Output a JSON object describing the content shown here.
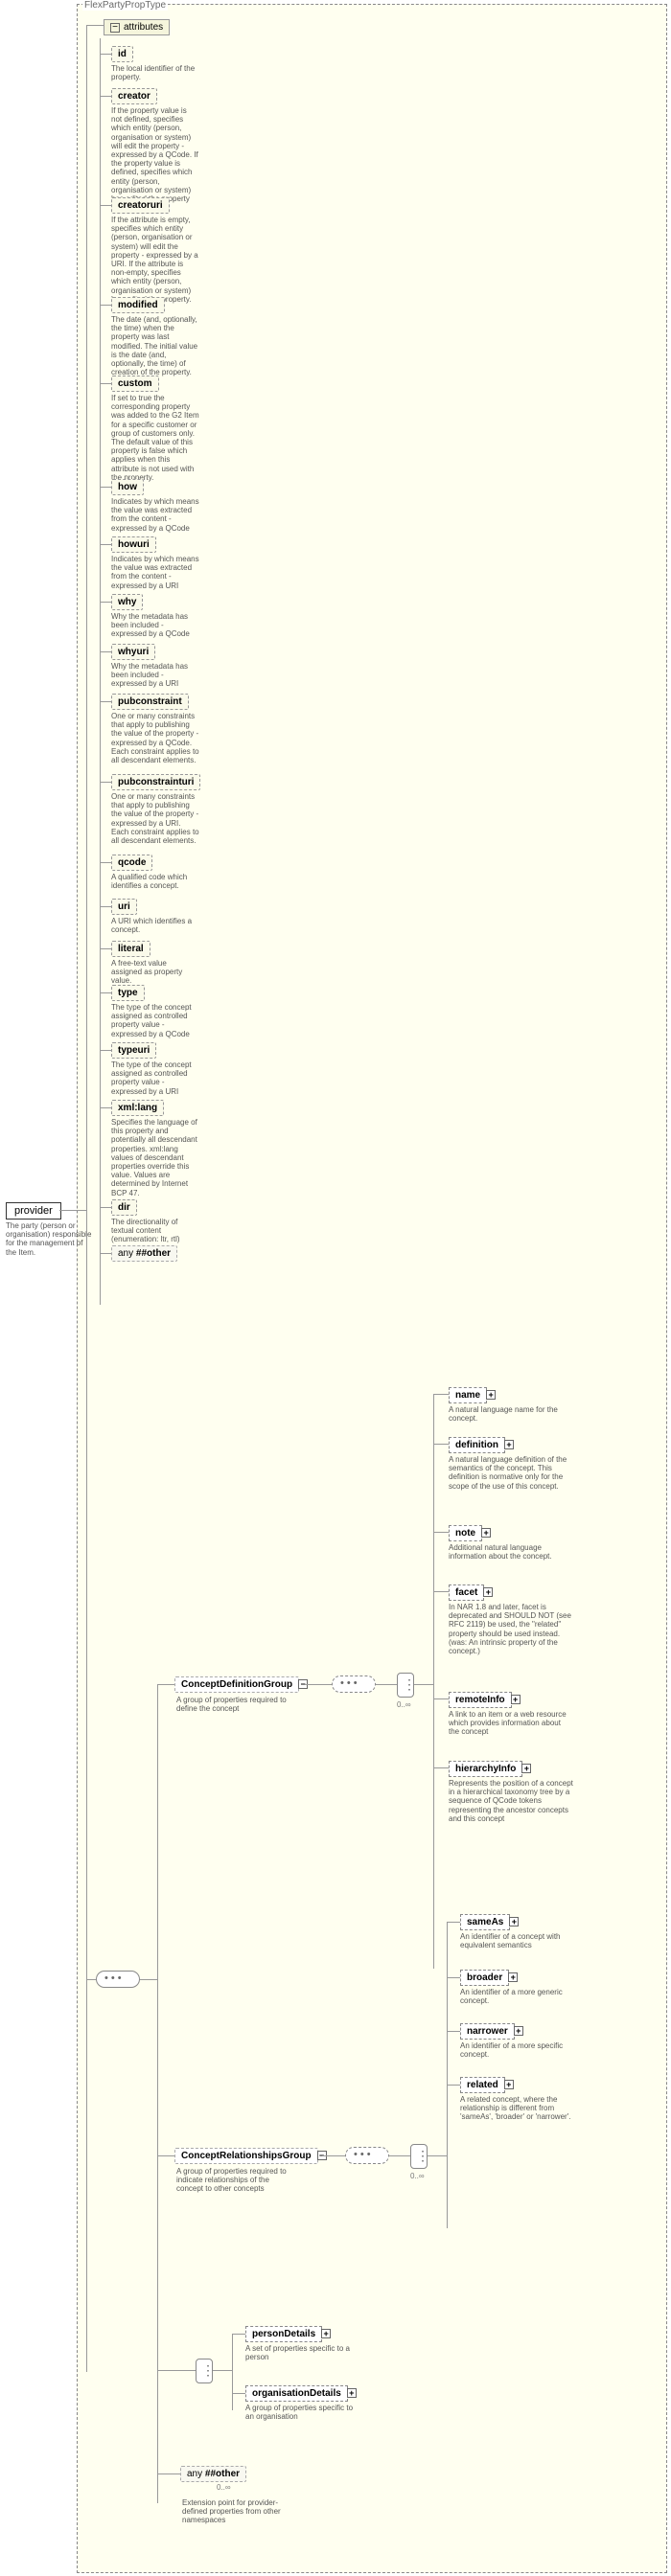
{
  "outer_type": "FlexPartyPropType",
  "root": {
    "name": "provider",
    "desc": "The party (person or organisation) responsible for the management of the Item."
  },
  "attributes_label": "attributes",
  "attributes": [
    {
      "name": "id",
      "desc": "The local identifier of the property."
    },
    {
      "name": "creator",
      "desc": "If the property value is not defined, specifies which entity (person, organisation or system) will edit the property - expressed by a QCode. If the property value is defined, specifies which entity (person, organisation or system) has edited the property value."
    },
    {
      "name": "creatoruri",
      "desc": "If the attribute is empty, specifies which entity (person, organisation or system) will edit the property - expressed by a URI. If the attribute is non-empty, specifies which entity (person, organisation or system) has edited the property."
    },
    {
      "name": "modified",
      "desc": "The date (and, optionally, the time) when the property was last modified. The initial value is the date (and, optionally, the time) of creation of the property."
    },
    {
      "name": "custom",
      "desc": "If set to true the corresponding property was added to the G2 Item for a specific customer or group of customers only. The default value of this property is false which applies when this attribute is not used with the property."
    },
    {
      "name": "how",
      "desc": "Indicates by which means the value was extracted from the content - expressed by a QCode"
    },
    {
      "name": "howuri",
      "desc": "Indicates by which means the value was extracted from the content - expressed by a URI"
    },
    {
      "name": "why",
      "desc": "Why the metadata has been included - expressed by a QCode"
    },
    {
      "name": "whyuri",
      "desc": "Why the metadata has been included - expressed by a URI"
    },
    {
      "name": "pubconstraint",
      "desc": "One or many constraints that apply to publishing the value of the property - expressed by a QCode. Each constraint applies to all descendant elements."
    },
    {
      "name": "pubconstrainturi",
      "desc": "One or many constraints that apply to publishing the value of the property - expressed by a URI. Each constraint applies to all descendant elements."
    },
    {
      "name": "qcode",
      "desc": "A qualified code which identifies a concept."
    },
    {
      "name": "uri",
      "desc": "A URI which identifies a concept."
    },
    {
      "name": "literal",
      "desc": "A free-text value assigned as property value."
    },
    {
      "name": "type",
      "desc": "The type of the concept assigned as controlled property value - expressed by a QCode"
    },
    {
      "name": "typeuri",
      "desc": "The type of the concept assigned as controlled property value - expressed by a URI"
    },
    {
      "name": "xml:lang",
      "desc": "Specifies the language of this property and potentially all descendant properties. xml:lang values of descendant properties override this value. Values are determined by Internet BCP 47."
    },
    {
      "name": "dir",
      "desc": "The directionality of textual content (enumeration: ltr, rtl)"
    }
  ],
  "any_other": "##other",
  "any_label": "any",
  "groups": {
    "def": {
      "name": "ConceptDefinitionGroup",
      "desc": "A group of properties required to define the concept"
    },
    "rel": {
      "name": "ConceptRelationshipsGroup",
      "desc": "A group of properties required to indicate relationships of the concept to other concepts"
    }
  },
  "def_children": [
    {
      "name": "name",
      "desc": "A natural language name for the concept."
    },
    {
      "name": "definition",
      "desc": "A natural language definition of the semantics of the concept. This definition is normative only for the scope of the use of this concept."
    },
    {
      "name": "note",
      "desc": "Additional natural language information about the concept."
    },
    {
      "name": "facet",
      "desc": "In NAR 1.8 and later, facet is deprecated and SHOULD NOT (see RFC 2119) be used, the \"related\" property should be used instead.(was: An intrinsic property of the concept.)"
    },
    {
      "name": "remoteInfo",
      "desc": "A link to an item or a web resource which provides information about the concept"
    },
    {
      "name": "hierarchyInfo",
      "desc": "Represents the position of a concept in a hierarchical taxonomy tree by a sequence of QCode tokens representing the ancestor concepts and this concept"
    }
  ],
  "rel_children": [
    {
      "name": "sameAs",
      "desc": "An identifier of a concept with equivalent semantics"
    },
    {
      "name": "broader",
      "desc": "An identifier of a more generic concept."
    },
    {
      "name": "narrower",
      "desc": "An identifier of a more specific concept."
    },
    {
      "name": "related",
      "desc": "A related concept, where the relationship is different from 'sameAs', 'broader' or 'narrower'."
    }
  ],
  "choice_children": [
    {
      "name": "personDetails",
      "desc": "A set of properties specific to a person"
    },
    {
      "name": "organisationDetails",
      "desc": "A group of properties specific to an organisation"
    }
  ],
  "any_ext": {
    "label": "##other",
    "desc": "Extension point for provider-defined properties from other namespaces"
  },
  "card": "0..∞"
}
